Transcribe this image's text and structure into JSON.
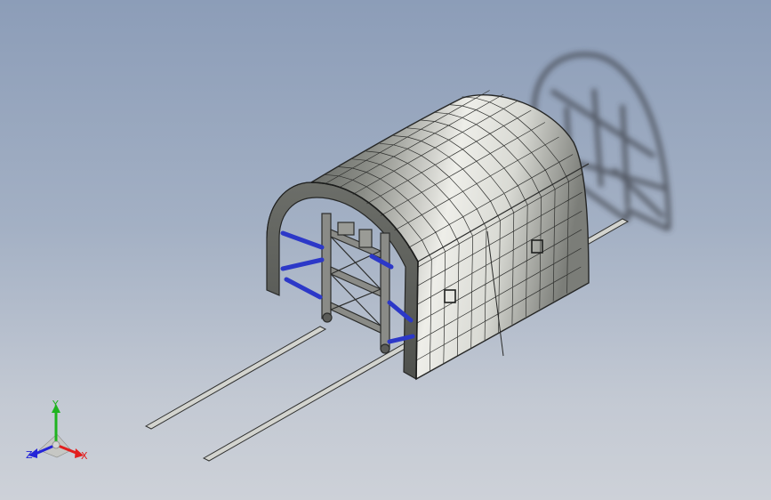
{
  "viewport": {
    "model": "tunnel-formwork-trolley",
    "colors": {
      "background_top": "#8c9db8",
      "background_bottom": "#cdd1d8",
      "shell_light": "#e6e7e2",
      "shell_dark": "#5f625e",
      "edge": "#2a2b2a",
      "bracing": "#2c38c8",
      "shadow": "#3a3d44"
    }
  },
  "triad": {
    "x_label": "X",
    "y_label": "Y",
    "z_label": "Z",
    "x_color": "#e21e1e",
    "y_color": "#1fb31f",
    "z_color": "#2424d8"
  }
}
